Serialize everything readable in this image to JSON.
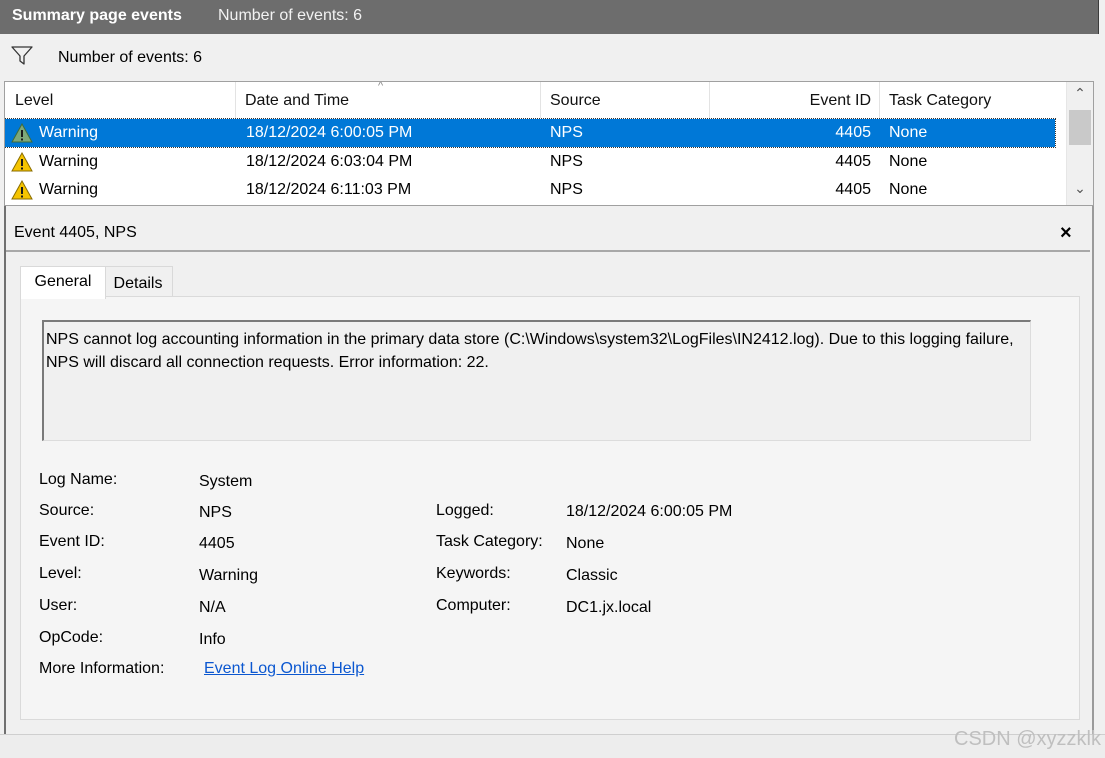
{
  "titlebar": {
    "title": "Summary page events",
    "count_text": "Number of events: 6"
  },
  "filter": {
    "count_text": "Number of events: 6"
  },
  "grid": {
    "columns": [
      "Level",
      "Date and Time",
      "Source",
      "Event ID",
      "Task Category"
    ],
    "sort_indicator": "^",
    "rows": [
      {
        "level": "Warning",
        "datetime": "18/12/2024 6:00:05 PM",
        "source": "NPS",
        "event_id": "4405",
        "task_category": "None",
        "selected": true
      },
      {
        "level": "Warning",
        "datetime": "18/12/2024 6:03:04 PM",
        "source": "NPS",
        "event_id": "4405",
        "task_category": "None",
        "selected": false
      },
      {
        "level": "Warning",
        "datetime": "18/12/2024 6:11:03 PM",
        "source": "NPS",
        "event_id": "4405",
        "task_category": "None",
        "selected": false
      }
    ],
    "scroll_up": "⌃",
    "scroll_down": "⌄"
  },
  "detail": {
    "title": "Event 4405, NPS",
    "close": "×",
    "tabs": {
      "general": "General",
      "details": "Details"
    },
    "message": "NPS cannot log accounting information in the primary data store (C:\\Windows\\system32\\LogFiles\\IN2412.log). Due to this logging failure, NPS will discard all connection requests. Error information: 22.",
    "props": {
      "log_name_label": "Log Name:",
      "log_name": "System",
      "source_label": "Source:",
      "source": "NPS",
      "logged_label": "Logged:",
      "logged": "18/12/2024 6:00:05 PM",
      "event_id_label": "Event ID:",
      "event_id": "4405",
      "task_category_label": "Task Category:",
      "task_category": "None",
      "level_label": "Level:",
      "level": "Warning",
      "keywords_label": "Keywords:",
      "keywords": "Classic",
      "user_label": "User:",
      "user": "N/A",
      "computer_label": "Computer:",
      "computer": "DC1.jx.local",
      "opcode_label": "OpCode:",
      "opcode": "Info",
      "more_info_label": "More Information:",
      "more_info_link": "Event Log Online Help"
    }
  },
  "watermark": "CSDN @xyzzklk",
  "icons": {
    "filter": "funnel-icon",
    "warning": "warning-triangle-icon"
  },
  "colors": {
    "selection": "#0078d7",
    "titlebar": "#6d6d6d",
    "link": "#0b57d0",
    "warning": "#f5c400"
  }
}
